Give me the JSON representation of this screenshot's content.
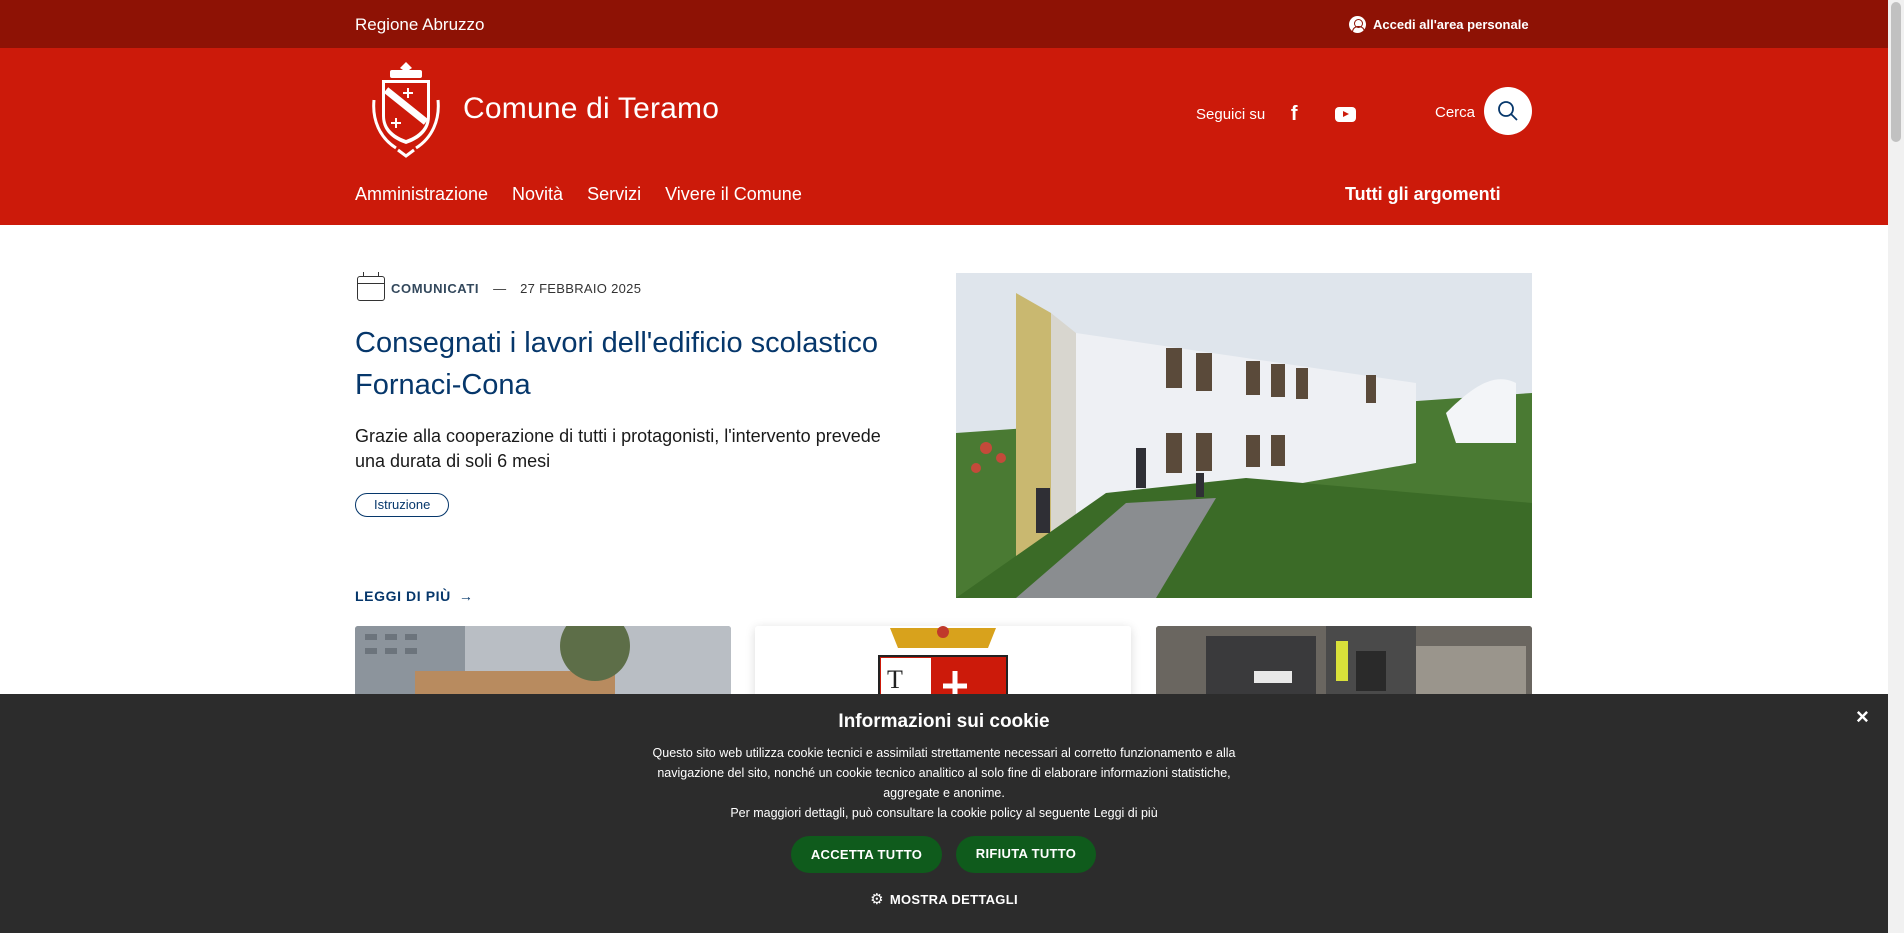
{
  "topbar": {
    "region": "Regione Abruzzo",
    "login": "Accedi all'area personale"
  },
  "header": {
    "site_title": "Comune di Teramo",
    "follow_label": "Seguici su",
    "facebook_glyph": "f",
    "search_label": "Cerca",
    "nav": [
      "Amministrazione",
      "Novità",
      "Servizi",
      "Vivere il Comune"
    ],
    "nav_right": "Tutti gli argomenti",
    "colors": {
      "topbar": "#8e1205",
      "header": "#cc1a0a"
    }
  },
  "hero": {
    "category": "COMUNICATI",
    "separator": "—",
    "date": "27 FEBBRAIO 2025",
    "title": "Consegnati i lavori dell'edificio scolastico Fornaci-Cona",
    "description": "Grazie alla cooperazione di tutti i protagonisti, l'intervento prevede una durata di soli 6 mesi",
    "tag": "Istruzione",
    "read_more": "LEGGI DI PIÙ",
    "read_more_arrow": "→",
    "title_color": "#06376b"
  },
  "cookie": {
    "title": "Informazioni sui cookie",
    "text_line1": "Questo sito web utilizza cookie tecnici e assimilati strettamente necessari al corretto funzionamento e alla navigazione del sito, nonché un cookie tecnico analitico al solo fine di elaborare informazioni statistiche, aggregate e anonime.",
    "text_line2": "Per maggiori dettagli, può consultare la cookie policy al seguente Leggi di più",
    "accept": "ACCETTA TUTTO",
    "reject": "RIFIUTA TUTTO",
    "details": "MOSTRA DETTAGLI",
    "close_glyph": "×",
    "gear_glyph": "⚙",
    "button_color": "#0f5b1c"
  },
  "icons": [
    "user-icon",
    "crest-logo",
    "facebook-icon",
    "youtube-icon",
    "search-icon",
    "calendar-icon",
    "arrow-right-icon",
    "close-icon",
    "gear-icon"
  ]
}
